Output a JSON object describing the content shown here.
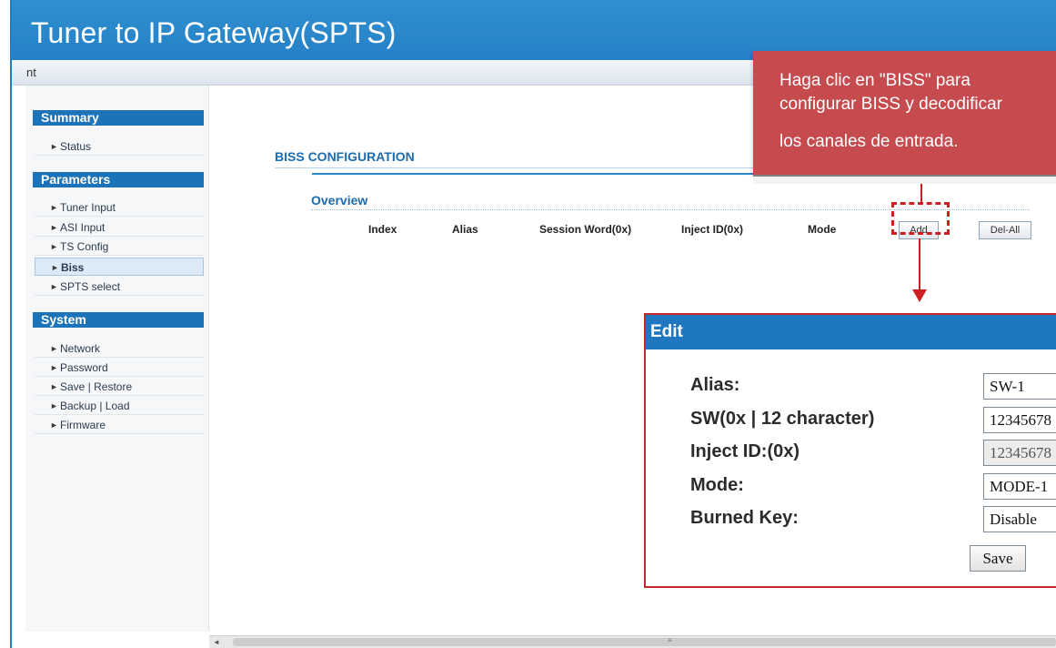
{
  "window": {
    "title": "Tuner to IP Gateway(SPTS)"
  },
  "menubar": {
    "text": "nt"
  },
  "sidebar": {
    "sections": [
      {
        "title": "Summary",
        "items": [
          {
            "label": "Status"
          }
        ]
      },
      {
        "title": "Parameters",
        "items": [
          {
            "label": "Tuner Input"
          },
          {
            "label": "ASI Input"
          },
          {
            "label": "TS Config"
          },
          {
            "label": "Biss",
            "active": true
          },
          {
            "label": "SPTS select"
          }
        ]
      },
      {
        "title": "System",
        "items": [
          {
            "label": "Network"
          },
          {
            "label": "Password"
          },
          {
            "label": "Save | Restore"
          },
          {
            "label": "Backup | Load"
          },
          {
            "label": "Firmware"
          }
        ]
      }
    ],
    "arrow_glyph": "►"
  },
  "main": {
    "title": "BISS CONFIGURATION",
    "overview": {
      "title": "Overview",
      "columns": [
        "Index",
        "Alias",
        "Session Word(0x)",
        "Inject ID(0x)",
        "Mode"
      ],
      "add_label": "Add",
      "del_all_label": "Del-All"
    }
  },
  "callout": {
    "lines": [
      "Haga clic en \"BISS\" para",
      "configurar BISS y decodificar",
      "los canales de entrada."
    ],
    "color": "#c54b4f"
  },
  "edit": {
    "title": "Edit",
    "fields": [
      {
        "label": "Alias:",
        "value": "SW-1"
      },
      {
        "label": "SW(0x | 12 character)",
        "value": "12345678"
      },
      {
        "label": "Inject ID:(0x)",
        "value": "12345678",
        "readonly": true
      },
      {
        "label": "Mode:",
        "value": "MODE-1"
      },
      {
        "label": "Burned Key:",
        "value": "Disable"
      }
    ],
    "save_label": "Save"
  },
  "colors": {
    "header_blue": "#2581c6",
    "section_blue": "#1d73b8",
    "highlight_red": "#cc1f1f"
  }
}
